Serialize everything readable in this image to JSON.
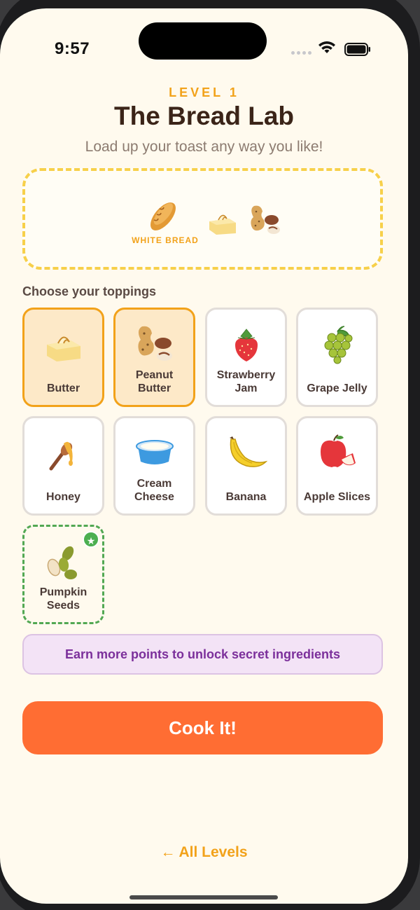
{
  "status_bar": {
    "time": "9:57"
  },
  "header": {
    "level": "LEVEL 1",
    "title": "The Bread Lab",
    "subtitle": "Load up your toast any way you like!"
  },
  "toast_plate": {
    "bread_label": "WHITE BREAD",
    "items": [
      "bread-icon",
      "butter-icon",
      "peanut-butter-icon"
    ]
  },
  "section_label": "Choose your toppings",
  "toppings": [
    {
      "label": "Butter",
      "icon": "butter-icon",
      "state": "selected"
    },
    {
      "label": "Peanut Butter",
      "icon": "peanut-butter-icon",
      "state": "selected"
    },
    {
      "label": "Strawberry Jam",
      "icon": "strawberry-icon",
      "state": "default"
    },
    {
      "label": "Grape Jelly",
      "icon": "grapes-icon",
      "state": "default"
    },
    {
      "label": "Honey",
      "icon": "honey-dipper-icon",
      "state": "default"
    },
    {
      "label": "Cream Cheese",
      "icon": "cream-cheese-tub-icon",
      "state": "default"
    },
    {
      "label": "Banana",
      "icon": "banana-icon",
      "state": "default"
    },
    {
      "label": "Apple Slices",
      "icon": "apple-icon",
      "state": "default"
    },
    {
      "label": "Pumpkin Seeds",
      "icon": "pumpkin-seeds-icon",
      "state": "secret",
      "badge": "★"
    }
  ],
  "unlock_banner": "Earn more points to unlock secret ingredients",
  "cook_button": "Cook It!",
  "footer_link": "← All Levels",
  "colors": {
    "background": "#fffaee",
    "accent": "#f2a21a",
    "cook_button": "#ff6d33",
    "selected_bg": "#fde9c8",
    "secret_border": "#52a853",
    "banner_bg": "#f3e3f6",
    "banner_text": "#7b2f9b"
  }
}
